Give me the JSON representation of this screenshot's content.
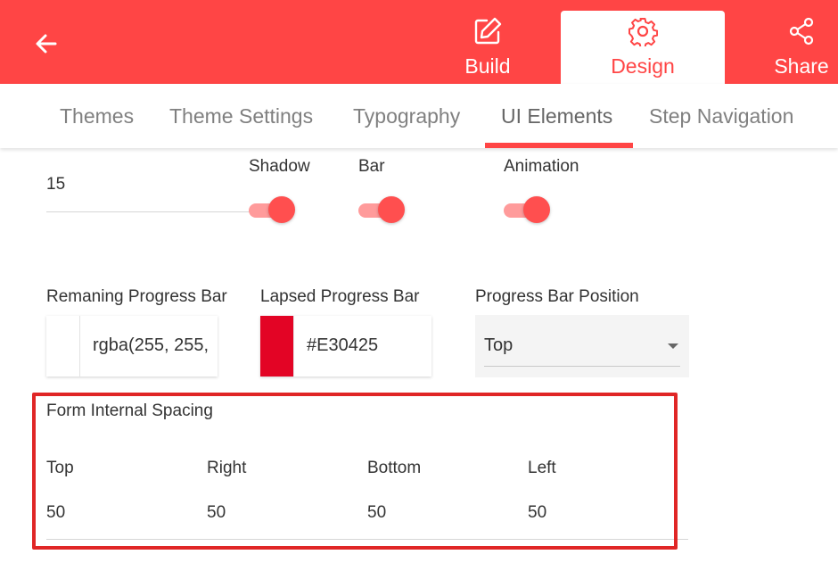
{
  "header": {
    "build_label": "Build",
    "design_label": "Design",
    "share_label": "Share",
    "active": "Design"
  },
  "tabs": [
    {
      "label": "Themes"
    },
    {
      "label": "Theme Settings"
    },
    {
      "label": "Typography"
    },
    {
      "label": "UI Elements",
      "active": true
    },
    {
      "label": "Step Navigation"
    }
  ],
  "ui_elements": {
    "spacing_value": "15",
    "shadow_label": "Shadow",
    "bar_label": "Bar",
    "animation_label": "Animation",
    "shadow_on": true,
    "bar_on": true,
    "animation_on": true,
    "remaining_label": "Remaning Progress Bar",
    "remaining_value": "rgba(255, 255,",
    "remaining_color": "#FFFFFF",
    "lapsed_label": "Lapsed Progress Bar",
    "lapsed_value": "#E30425",
    "lapsed_color": "#E30425",
    "position_label": "Progress Bar Position",
    "position_value": "Top",
    "form_spacing_title": "Form Internal Spacing",
    "spacing": {
      "top_label": "Top",
      "top_value": "50",
      "right_label": "Right",
      "right_value": "50",
      "bottom_label": "Bottom",
      "bottom_value": "50",
      "left_label": "Left",
      "left_value": "50"
    }
  },
  "colors": {
    "brand": "#FF4545",
    "highlight_border": "#E02626"
  }
}
